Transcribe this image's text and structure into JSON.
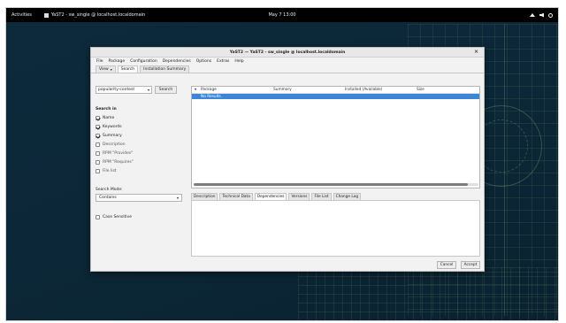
{
  "topbar": {
    "activities": "Activities",
    "app_name": "YaST2 - sw_single @ localhost.localdomain",
    "clock": "May 7  13:00"
  },
  "window": {
    "title": "YaST2 — YaST2 - sw_single @ localhost.localdomain",
    "close_glyph": "×"
  },
  "menu": [
    "File",
    "Package",
    "Configuration",
    "Dependencies",
    "Options",
    "Extras",
    "Help"
  ],
  "tabs": {
    "view": "View",
    "search": "Search",
    "installation_summary": "Installation Summary"
  },
  "search": {
    "combo_value": "popularity-contest",
    "button": "Search",
    "search_in_label": "Search in",
    "options": [
      {
        "label": "Name",
        "checked": true
      },
      {
        "label": "Keywords",
        "checked": true
      },
      {
        "label": "Summary",
        "checked": true
      },
      {
        "label": "Description",
        "checked": false
      },
      {
        "label": "RPM \"Provides\"",
        "checked": false
      },
      {
        "label": "RPM \"Requires\"",
        "checked": false
      },
      {
        "label": "File list",
        "checked": false
      }
    ],
    "mode_label": "Search Mode:",
    "mode_value": "Contains",
    "case_sensitive": "Case Sensitive"
  },
  "table": {
    "columns": [
      "Package",
      "Summary",
      "Installed (Available)",
      "Size"
    ],
    "sort_glyph": "▾",
    "row": "No Results."
  },
  "detail_tabs": [
    "Description",
    "Technical Data",
    "Dependencies",
    "Versions",
    "File List",
    "Change Log"
  ],
  "detail_active": 2,
  "buttons": {
    "cancel": "Cancel",
    "accept": "Accept"
  }
}
